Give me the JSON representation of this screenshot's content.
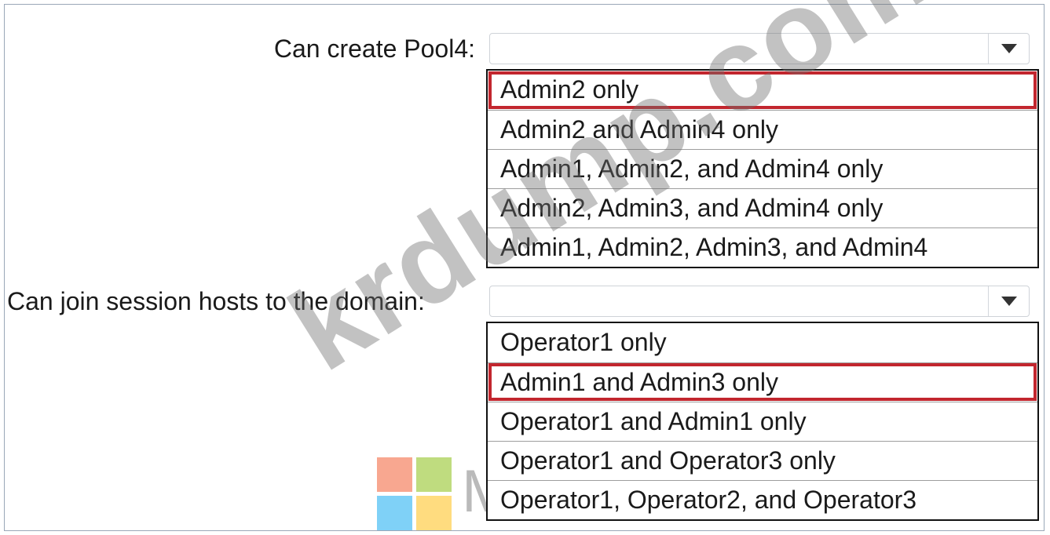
{
  "question1": {
    "label": "Can create Pool4:",
    "selected_value": "",
    "options": [
      "Admin2 only",
      "Admin2 and Admin4 only",
      "Admin1, Admin2, and Admin4 only",
      "Admin2, Admin3, and Admin4 only",
      "Admin1, Admin2, Admin3, and Admin4"
    ],
    "highlighted_option": "Admin2 only"
  },
  "question2": {
    "label": "Can join session hosts to the domain:",
    "selected_value": "",
    "options": [
      "Operator1 only",
      "Admin1 and Admin3 only",
      "Operator1 and Admin1 only",
      "Operator1 and Operator3 only",
      "Operator1, Operator2, and Operator3"
    ],
    "highlighted_option": "Admin1 and Admin3 only"
  },
  "watermark": {
    "text": "krdump.com",
    "brand_text": "Microsoft"
  },
  "icons": {
    "dropdown": "chevron-down-icon",
    "logo": "microsoft-logo-icon"
  },
  "colors": {
    "highlight": "#c2262e",
    "logo_red": "#f25022",
    "logo_green": "#7fba00",
    "logo_blue": "#00a4ef",
    "logo_yellow": "#ffb900"
  }
}
